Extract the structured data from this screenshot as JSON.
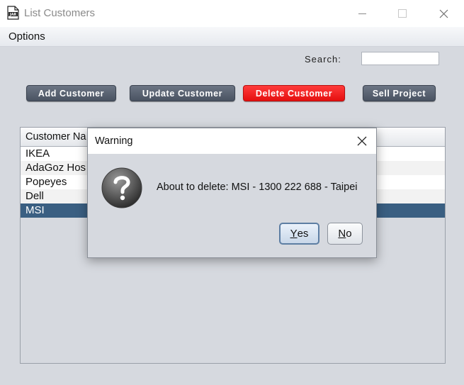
{
  "window": {
    "title": "List Customers",
    "minimize_glyph": "—",
    "maximize_glyph": "☐",
    "close_glyph": "✕"
  },
  "menu": {
    "options_label": "Options"
  },
  "search": {
    "label": "Search:",
    "value": ""
  },
  "toolbar": {
    "add_label": "Add Customer",
    "update_label": "Update Customer",
    "delete_label": "Delete Customer",
    "sell_label": "Sell Project",
    "delete_color": "#f01818"
  },
  "table": {
    "columns": [
      "Customer Na"
    ],
    "rows": [
      "IKEA",
      "AdaGoz Hos",
      "Popeyes",
      "Dell",
      "MSI"
    ],
    "selected_index": 4,
    "selected_color": "#3a5f82"
  },
  "dialog": {
    "title": "Warning",
    "message": "About to delete: MSI - 1300 222 688 - Taipei",
    "icon": "question-icon",
    "yes_mnemonic": "Y",
    "yes_rest": "es",
    "no_mnemonic": "N",
    "no_rest": "o"
  }
}
